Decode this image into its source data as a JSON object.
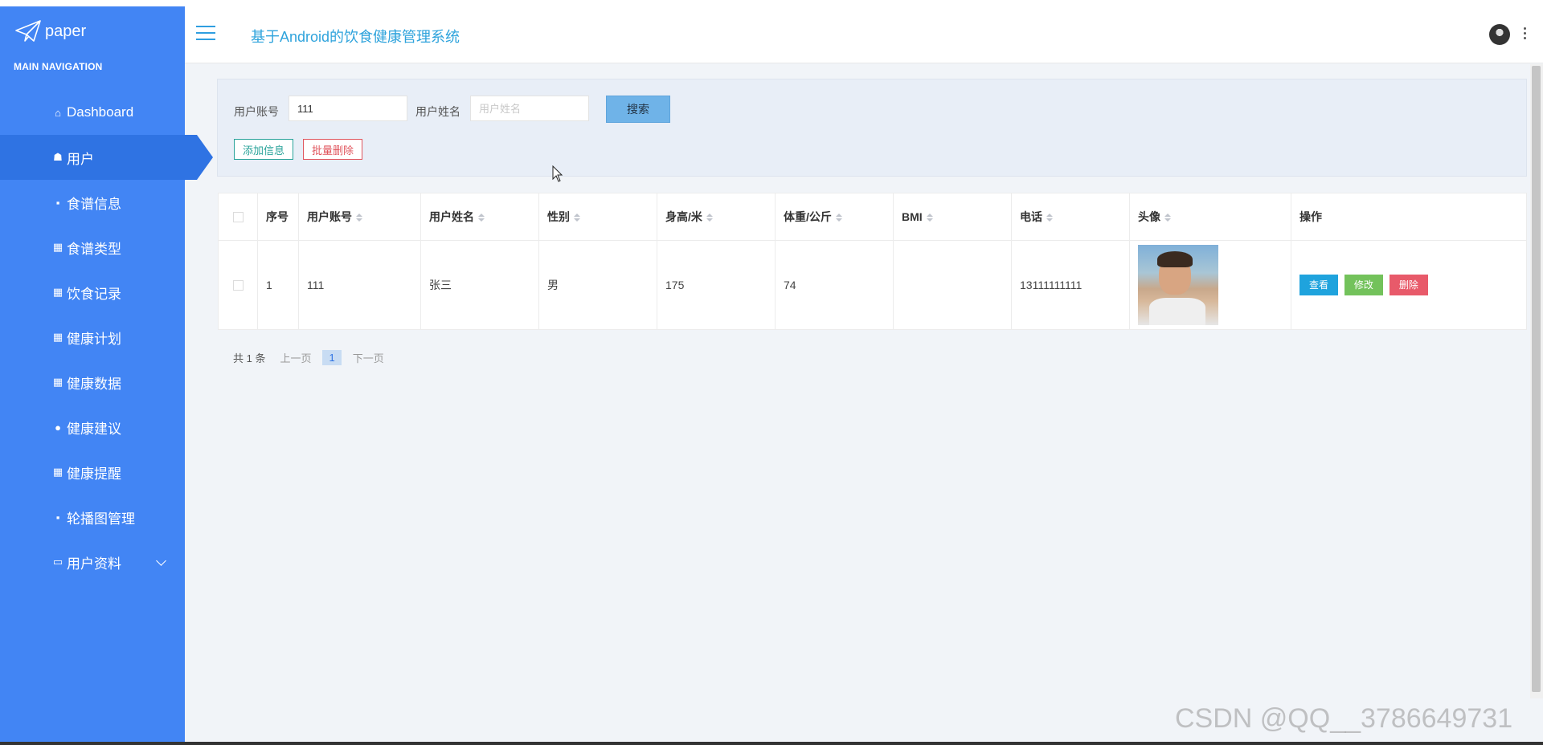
{
  "app": {
    "logo_text": "paper",
    "title": "基于Android的饮食健康管理系统"
  },
  "sidebar": {
    "section_title": "MAIN NAVIGATION",
    "items": [
      {
        "label": "Dashboard",
        "icon": "home-icon"
      },
      {
        "label": "用户",
        "icon": "user-icon",
        "active": true
      },
      {
        "label": "食谱信息",
        "icon": "clipboard-icon"
      },
      {
        "label": "食谱类型",
        "icon": "grid-icon"
      },
      {
        "label": "饮食记录",
        "icon": "grid-icon"
      },
      {
        "label": "健康计划",
        "icon": "grid-icon"
      },
      {
        "label": "健康数据",
        "icon": "grid-icon"
      },
      {
        "label": "健康建议",
        "icon": "person-icon"
      },
      {
        "label": "健康提醒",
        "icon": "grid-icon"
      },
      {
        "label": "轮播图管理",
        "icon": "clipboard-icon"
      },
      {
        "label": "用户资料",
        "icon": "card-icon",
        "has_submenu": true
      }
    ],
    "colors": {
      "bg": "#4285f4",
      "active": "#2f73e3"
    }
  },
  "search": {
    "account_label": "用户账号",
    "account_value": "111",
    "name_label": "用户姓名",
    "name_placeholder": "用户姓名",
    "search_button": "搜索",
    "add_button": "添加信息",
    "batch_delete_button": "批量删除"
  },
  "table": {
    "headers": [
      "序号",
      "用户账号",
      "用户姓名",
      "性别",
      "身高/米",
      "体重/公斤",
      "BMI",
      "电话",
      "头像",
      "操作"
    ],
    "rows": [
      {
        "index": "1",
        "account": "111",
        "name": "张三",
        "gender": "男",
        "height": "175",
        "weight": "74",
        "bmi": "",
        "phone": "13111111111"
      }
    ],
    "actions": {
      "view": "查看",
      "edit": "修改",
      "delete": "删除"
    }
  },
  "pagination": {
    "total": "共 1 条",
    "prev": "上一页",
    "current": "1",
    "next": "下一页"
  },
  "watermark": "CSDN @QQ__3786649731"
}
